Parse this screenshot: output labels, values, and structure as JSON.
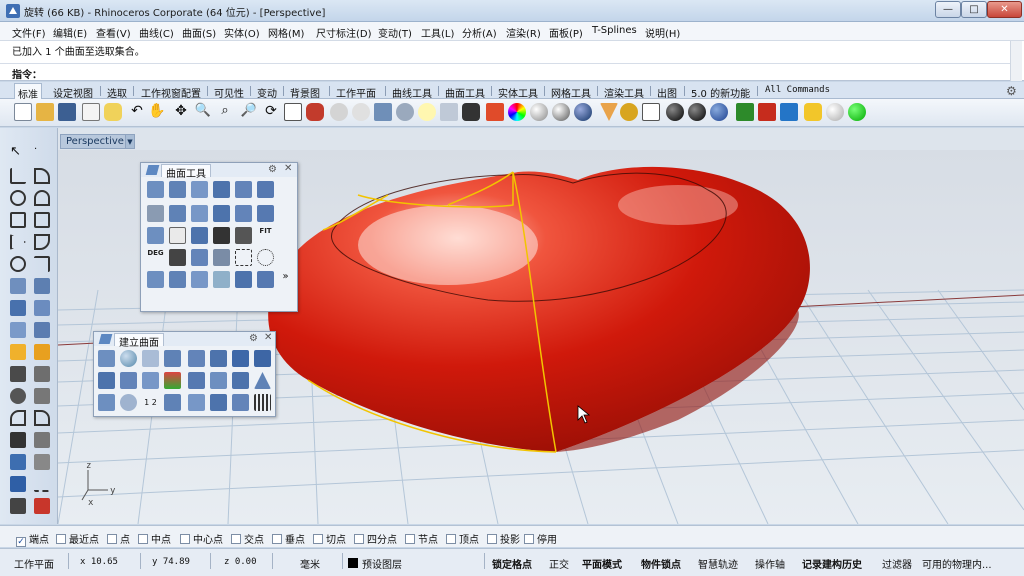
{
  "window": {
    "title": "旋转 (66 KB) - Rhinoceros Corporate (64 位元) - [Perspective]",
    "min_label": "—",
    "max_label": "□",
    "close_label": "✕"
  },
  "menu": [
    "文件(F)",
    "编辑(E)",
    "查看(V)",
    "曲线(C)",
    "曲面(S)",
    "实体(O)",
    "网格(M)",
    "尺寸标注(D)",
    "变动(T)",
    "工具(L)",
    "分析(A)",
    "渲染(R)",
    "面板(P)",
    "T-Splines",
    "说明(H)"
  ],
  "command": {
    "history": "已加入 1 个曲面至选取集合。",
    "prompt": "指令：",
    "value": ""
  },
  "toolbar_tabs": [
    "标准",
    "设定视图",
    "选取",
    "工作视窗配置",
    "可见性",
    "变动",
    "背景图",
    "工作平面",
    "曲线工具",
    "曲面工具",
    "实体工具",
    "网格工具",
    "渲染工具",
    "出图",
    "5.0 的新功能",
    "All Commands"
  ],
  "viewport": {
    "name": "Perspective",
    "axis_x": "x",
    "axis_y": "y",
    "axis_z": "z"
  },
  "panels": {
    "surface_tools": {
      "title": "曲面工具",
      "more": "»",
      "deg_label": "DEG",
      "fit_label": "FIT"
    },
    "create_surface": {
      "title": "建立曲面",
      "num_label": "1 2"
    }
  },
  "osnap": [
    {
      "label": "端点",
      "checked": true
    },
    {
      "label": "最近点",
      "checked": false
    },
    {
      "label": "点",
      "checked": false
    },
    {
      "label": "中点",
      "checked": false
    },
    {
      "label": "中心点",
      "checked": false
    },
    {
      "label": "交点",
      "checked": false
    },
    {
      "label": "垂点",
      "checked": false
    },
    {
      "label": "切点",
      "checked": false
    },
    {
      "label": "四分点",
      "checked": false
    },
    {
      "label": "节点",
      "checked": false
    },
    {
      "label": "顶点",
      "checked": false
    },
    {
      "label": "投影",
      "checked": false
    },
    {
      "label": "停用",
      "checked": false
    }
  ],
  "status": {
    "cplane": "工作平面",
    "x": "x 10.65",
    "y": "y 74.89",
    "z": "z 0.00",
    "unit": "毫米",
    "layer": "预设图层",
    "grid_snap": "锁定格点",
    "ortho": "正交",
    "planar": "平面模式",
    "object_snap": "物件锁点",
    "smart_track": "智慧轨迹",
    "gumball": "操作轴",
    "record_history": "记录建构历史",
    "filter": "过滤器",
    "memory": "可用的物理内..."
  },
  "colors": {
    "heart_red": "#d11a0c",
    "selection_yellow": "#f2c400",
    "grid_line": "#b4c6d8",
    "viewport_bg": "#dde4ec"
  }
}
